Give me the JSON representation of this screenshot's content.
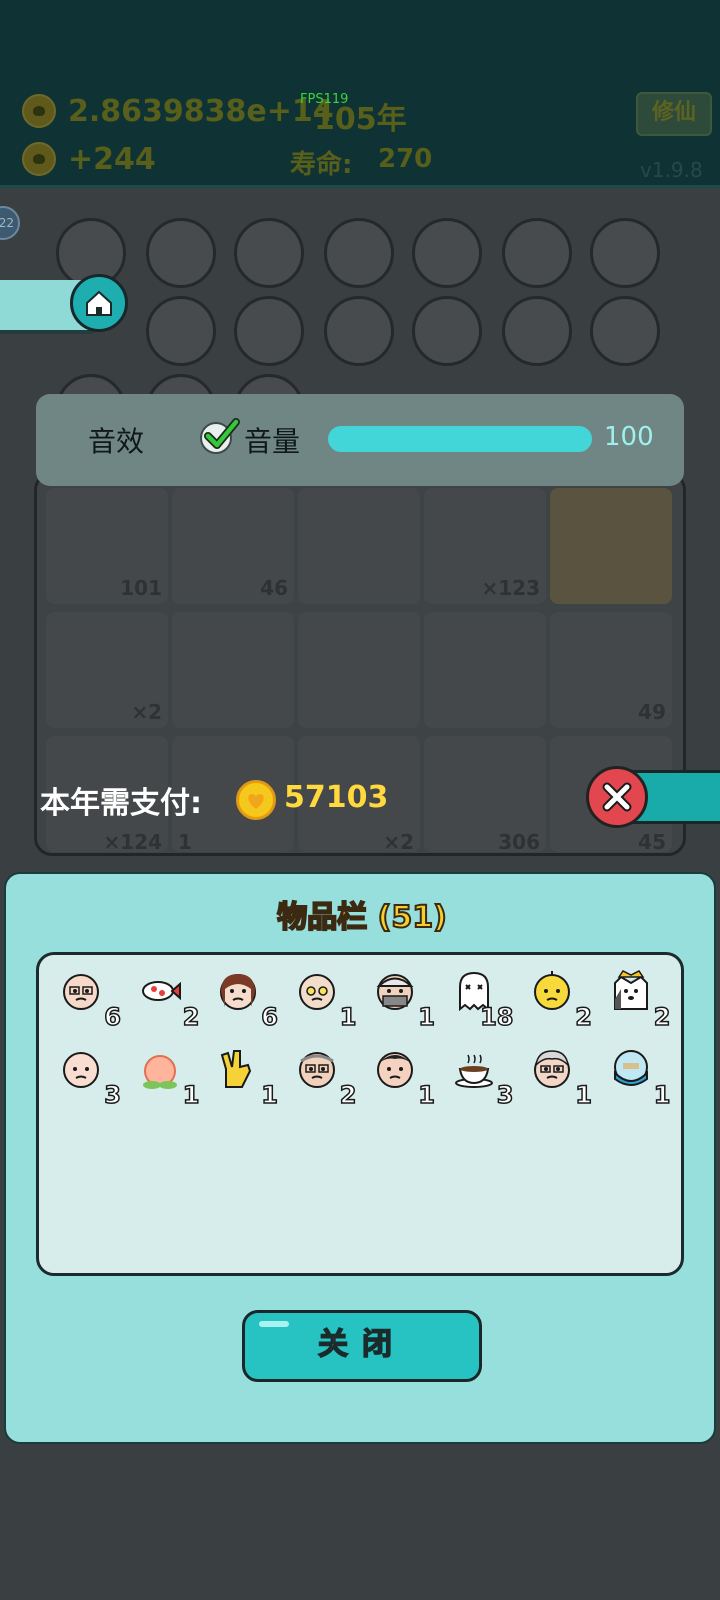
{
  "header": {
    "money": "2.8639838e+14",
    "year": "105年",
    "fps": "FPS119",
    "income": "+244",
    "lifespan_label": "寿命:",
    "lifespan_value": "270",
    "version": "v1.9.8",
    "xiuxian": "修仙"
  },
  "board": {
    "card_counts": [
      "101",
      "46",
      "",
      "×123",
      "",
      "",
      "×2",
      "",
      "",
      "",
      "49",
      "×124",
      "1",
      "×2",
      "306",
      "45"
    ],
    "badge": "22"
  },
  "settings": {
    "sound_label": "音效",
    "sound_enabled": true,
    "volume_label": "音量",
    "volume_value": "100",
    "volume_fraction": 1.0
  },
  "payment": {
    "label": "本年需支付:",
    "amount": "57103"
  },
  "inventory": {
    "title": "物品栏 (51)",
    "items": [
      {
        "icon": "bald-old-man-icon",
        "count": "6"
      },
      {
        "icon": "koi-fish-icon",
        "count": "2"
      },
      {
        "icon": "braided-girl-icon",
        "count": "6"
      },
      {
        "icon": "glasses-old-man-icon",
        "count": "1"
      },
      {
        "icon": "cap-man-icon",
        "count": "1"
      },
      {
        "icon": "ghost-icon",
        "count": "18"
      },
      {
        "icon": "yellow-bird-icon",
        "count": "2"
      },
      {
        "icon": "husky-king-icon",
        "count": "2"
      },
      {
        "icon": "bald-man-icon",
        "count": "3"
      },
      {
        "icon": "peach-icon",
        "count": "1"
      },
      {
        "icon": "hand-gesture-icon",
        "count": "1"
      },
      {
        "icon": "glasses-man-icon",
        "count": "2"
      },
      {
        "icon": "young-man-icon",
        "count": "1"
      },
      {
        "icon": "coffee-cup-icon",
        "count": "3"
      },
      {
        "icon": "white-hair-man-icon",
        "count": "1"
      },
      {
        "icon": "globe-bowl-icon",
        "count": "1"
      }
    ],
    "close_label": "关闭"
  },
  "colors": {
    "accent": "#27c2c2",
    "panel": "#96dfdd",
    "gold": "#ffd93d"
  }
}
